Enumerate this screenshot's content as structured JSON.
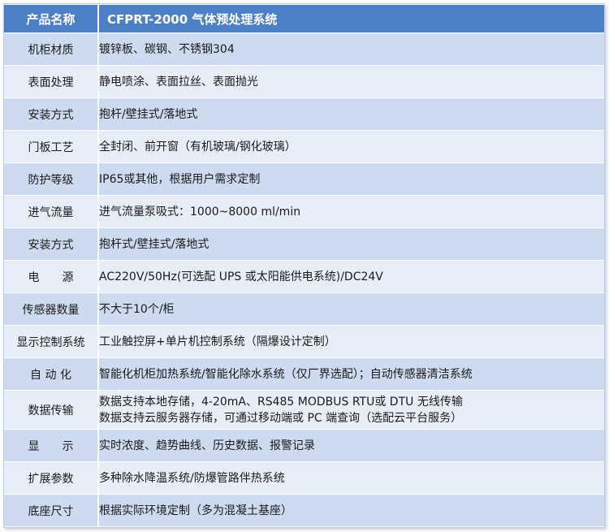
{
  "header": {
    "label": "产品名称",
    "value": "CFPRT-2000 气体预处理系统"
  },
  "rows": [
    {
      "label": "机柜材质",
      "value": [
        "镀锌板、碳钢、不锈钢304"
      ]
    },
    {
      "label": "表面处理",
      "value": [
        "静电喷涂、表面拉丝、表面抛光"
      ]
    },
    {
      "label": "安装方式",
      "value": [
        "抱杆/壁挂式/落地式"
      ]
    },
    {
      "label": "门板工艺",
      "value": [
        "全封闭、前开窗（有机玻璃/钢化玻璃）"
      ]
    },
    {
      "label": "防护等级",
      "value": [
        "IP65或其他，根据用户需求定制"
      ]
    },
    {
      "label": "进气流量",
      "value": [
        "进气流量泵吸式：1000~8000 ml/min"
      ]
    },
    {
      "label": "安装方式",
      "value": [
        "抱杆式/壁挂式/落地式"
      ]
    },
    {
      "label": "电　　源",
      "value": [
        "AC220V/50Hz(可选配 UPS 或太阳能供电系统)/DC24V"
      ]
    },
    {
      "label": "传感器数量",
      "value": [
        "不大于10个/柜"
      ]
    },
    {
      "label": "显示控制系统",
      "value": [
        "工业触控屏+单片机控制系统（隔爆设计定制）"
      ]
    },
    {
      "label": "自 动 化",
      "value": [
        "智能化机柜加热系统/智能化除水系统（仅厂界选配）；自动传感器清洁系统"
      ]
    },
    {
      "label": "数据传输",
      "value": [
        "数据支持本地存储，4-20mA、RS485 MODBUS RTU或 DTU 无线传输",
        "数据支持云服务器存储，可通过移动端或 PC 端查询（选配云平台服务）"
      ]
    },
    {
      "label": "显　　示",
      "value": [
        "实时浓度、趋势曲线、历史数据、报警记录"
      ]
    },
    {
      "label": "扩展参数",
      "value": [
        "多种除水降温系统/防爆管路伴热系统"
      ]
    },
    {
      "label": "底座尺寸",
      "value": [
        "根据实际环境定制（多为混凝土基座）"
      ]
    }
  ]
}
